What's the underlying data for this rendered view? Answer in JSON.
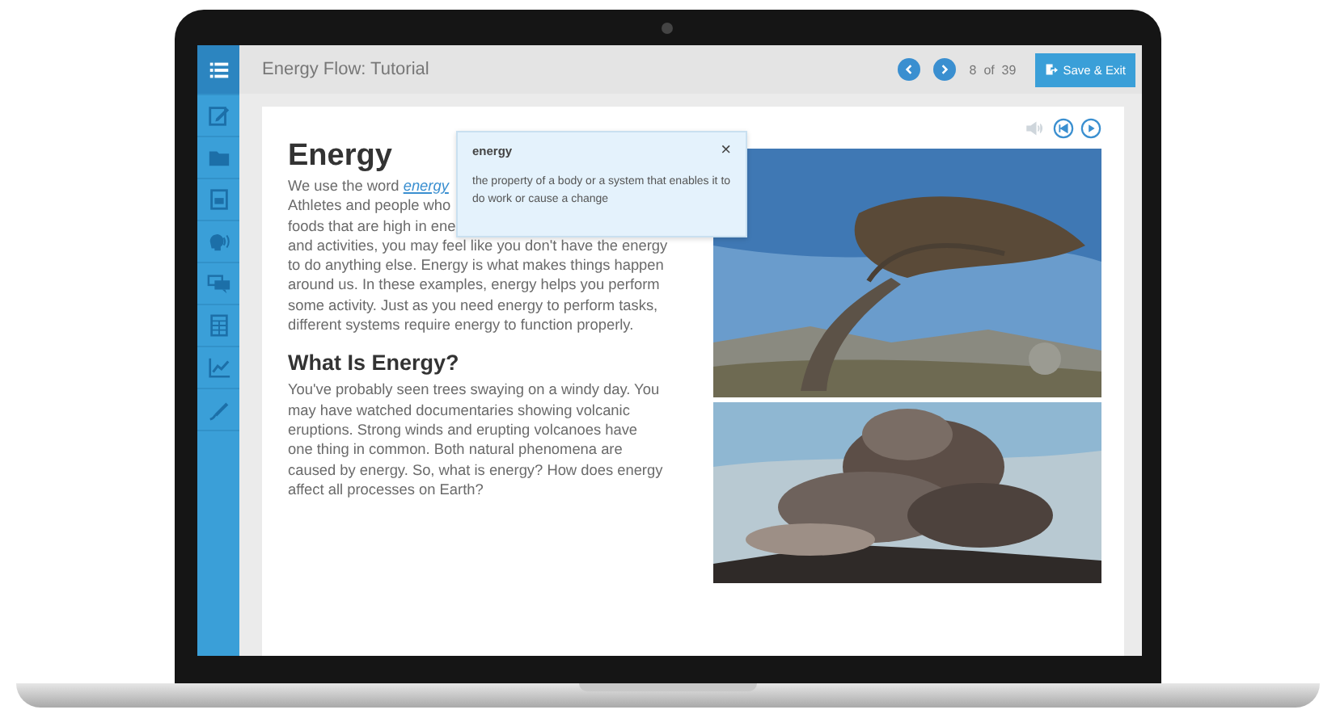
{
  "sidebar": {
    "items": [
      {
        "kind": "list",
        "selected": true
      },
      {
        "kind": "edit",
        "selected": false
      },
      {
        "kind": "folder",
        "selected": false
      },
      {
        "kind": "document",
        "selected": false
      },
      {
        "kind": "speech",
        "selected": false
      },
      {
        "kind": "chat",
        "selected": false
      },
      {
        "kind": "calculator",
        "selected": false
      },
      {
        "kind": "chart",
        "selected": false
      },
      {
        "kind": "pen",
        "selected": false
      }
    ]
  },
  "header": {
    "title": "Energy Flow: Tutorial",
    "page_current": "8",
    "page_of": "of",
    "page_total": "39",
    "save_button": "Save & Exit"
  },
  "article": {
    "title": "Energy",
    "paragraph_1": [
      {
        "text": "We use the word ",
        "link": "energy"
      },
      {
        "text": "Athletes and people who"
      },
      {
        "text": "foods that are high in ene"
      },
      {
        "text": "and activities, you may feel like you don't have the energy"
      },
      {
        "text": "to do anything else. Energy is what makes things happen"
      },
      {
        "text": "around us. In these examples, energy helps you perform"
      },
      {
        "text": "some activity. Just as you need energy to perform tasks,"
      },
      {
        "text": "different systems require energy to function properly."
      }
    ],
    "subtitle": "What Is Energy?",
    "paragraph_2": [
      "You've probably seen trees swaying on a windy day. You",
      "may have watched documentaries showing volcanic",
      "eruptions. Strong winds and erupting volcanoes have",
      "one thing in common. Both natural phenomena are",
      "caused by energy. So, what is energy? How does energy",
      "affect all processes on Earth?"
    ],
    "images": [
      {
        "kind": "tree"
      },
      {
        "kind": "volcano"
      }
    ]
  },
  "popup": {
    "term": "energy",
    "definition": "the property of a body or a system that enables it to do work or cause a change",
    "close": "×"
  }
}
